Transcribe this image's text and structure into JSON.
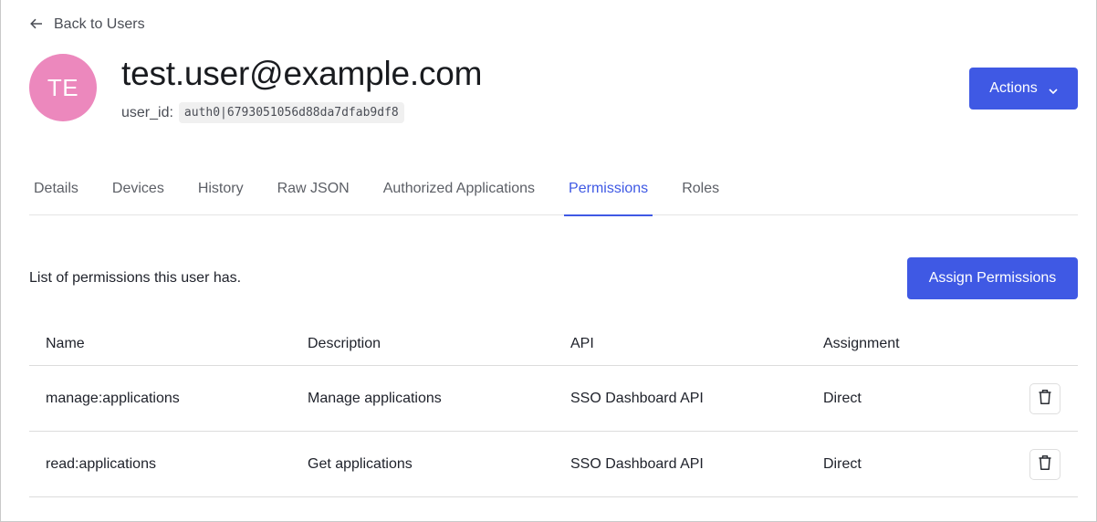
{
  "back_link": {
    "label": "Back to Users",
    "icon": "arrow-left-icon"
  },
  "user": {
    "initials": "TE",
    "avatar_color": "#ec88bd",
    "email": "test.user@example.com",
    "user_id_label": "user_id:",
    "user_id": "auth0|6793051056d88da7dfab9df8"
  },
  "header": {
    "actions_label": "Actions",
    "actions_icon": "chevron-down-icon"
  },
  "tabs": [
    {
      "label": "Details",
      "active": false
    },
    {
      "label": "Devices",
      "active": false
    },
    {
      "label": "History",
      "active": false
    },
    {
      "label": "Raw JSON",
      "active": false
    },
    {
      "label": "Authorized Applications",
      "active": false
    },
    {
      "label": "Permissions",
      "active": true
    },
    {
      "label": "Roles",
      "active": false
    }
  ],
  "permissions": {
    "description": "List of permissions this user has.",
    "assign_label": "Assign Permissions",
    "columns": [
      "Name",
      "Description",
      "API",
      "Assignment"
    ],
    "rows": [
      {
        "name": "manage:applications",
        "description": "Manage applications",
        "api": "SSO Dashboard API",
        "assignment": "Direct",
        "action_icon": "trash-icon"
      },
      {
        "name": "read:applications",
        "description": "Get applications",
        "api": "SSO Dashboard API",
        "assignment": "Direct",
        "action_icon": "trash-icon"
      }
    ]
  },
  "colors": {
    "accent": "#3f59e4",
    "text": "#1e212a",
    "muted": "#5c5f66"
  }
}
